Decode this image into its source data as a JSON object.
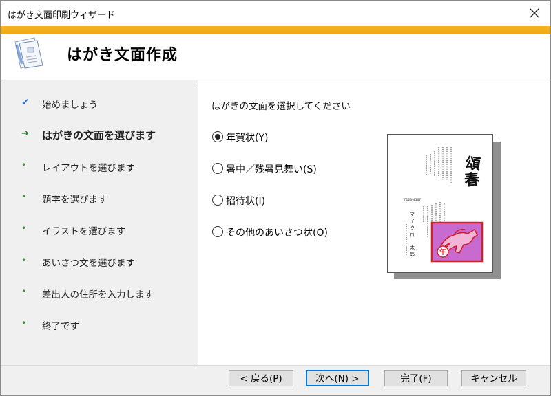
{
  "window": {
    "title": "はがき文面印刷ウィザード"
  },
  "header": {
    "title": "はがき文面作成"
  },
  "steps": [
    {
      "label": "始めましょう",
      "state": "done",
      "icon": "check-icon",
      "mark": "✔"
    },
    {
      "label": "はがきの文面を選びます",
      "state": "current",
      "icon": "arrow-icon",
      "mark": "➔"
    },
    {
      "label": "レイアウトを選びます",
      "state": "pending",
      "icon": "dot-icon",
      "mark": "•"
    },
    {
      "label": "題字を選びます",
      "state": "pending",
      "icon": "dot-icon",
      "mark": "•"
    },
    {
      "label": "イラストを選びます",
      "state": "pending",
      "icon": "dot-icon",
      "mark": "•"
    },
    {
      "label": "あいさつ文を選びます",
      "state": "pending",
      "icon": "dot-icon",
      "mark": "•"
    },
    {
      "label": "差出人の住所を入力します",
      "state": "pending",
      "icon": "dot-icon",
      "mark": "•"
    },
    {
      "label": "終了です",
      "state": "pending",
      "icon": "dot-icon",
      "mark": "•"
    }
  ],
  "content": {
    "instruction": "はがきの文面を選択してください",
    "options": [
      {
        "label": "年賀状(Y)",
        "selected": true
      },
      {
        "label": "暑中／残暑見舞い(S)",
        "selected": false
      },
      {
        "label": "招待状(I)",
        "selected": false
      },
      {
        "label": "その他のあいさつ状(O)",
        "selected": false
      }
    ],
    "preview": {
      "title_text": "頌春",
      "postal": "〒123-4567",
      "name_family": "マイクロ",
      "name_given": "太郎",
      "stamp_char": "午"
    }
  },
  "buttons": {
    "back": "< 戻る(P)",
    "next": "次へ(N) >",
    "finish": "完了(F)",
    "cancel": "キャンセル"
  },
  "colors": {
    "accent": "#f0a915",
    "sidebar_bg": "#f0f0f0",
    "default_button_border": "#0078d7",
    "stamp_bg": "#c86ad0",
    "stamp_border": "#d0202a"
  }
}
